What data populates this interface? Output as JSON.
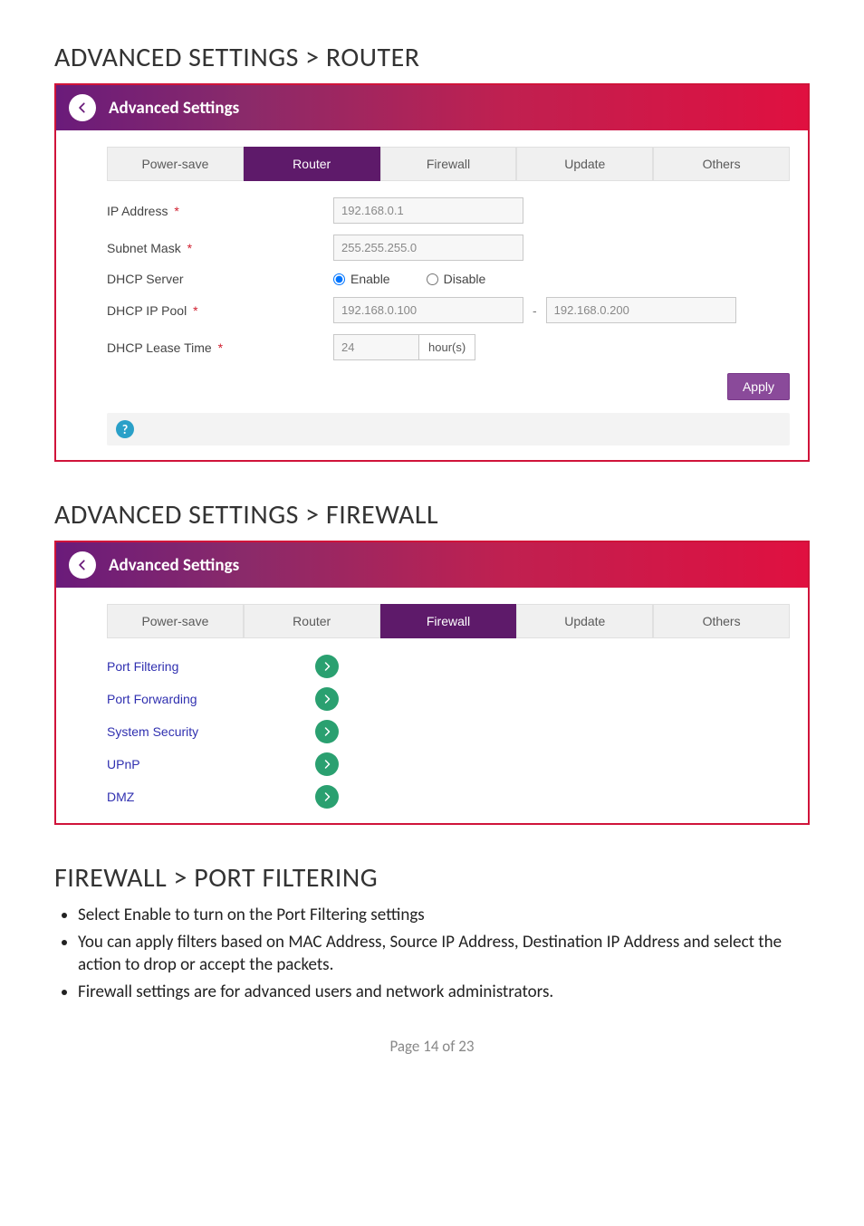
{
  "headings": {
    "router": "ADVANCED SETTINGS > ROUTER",
    "firewall": "ADVANCED SETTINGS > FIREWALL",
    "port_filtering": "FIREWALL > PORT FILTERING"
  },
  "panel": {
    "title": "Advanced Settings"
  },
  "tabs": {
    "power_save": "Power-save",
    "router": "Router",
    "firewall": "Firewall",
    "update": "Update",
    "others": "Others"
  },
  "router_form": {
    "ip_address_label": "IP Address",
    "ip_address_value": "192.168.0.1",
    "subnet_label": "Subnet Mask",
    "subnet_value": "255.255.255.0",
    "dhcp_server_label": "DHCP Server",
    "enable_label": "Enable",
    "disable_label": "Disable",
    "dhcp_pool_label": "DHCP IP Pool",
    "dhcp_pool_start": "192.168.0.100",
    "dhcp_pool_sep": "-",
    "dhcp_pool_end": "192.168.0.200",
    "lease_label": "DHCP Lease Time",
    "lease_value": "24",
    "lease_unit": "hour(s)",
    "required_mark": "*",
    "apply": "Apply",
    "help": "?"
  },
  "firewall_list": {
    "port_filtering": "Port Filtering",
    "port_forwarding": "Port Forwarding",
    "system_security": "System Security",
    "upnp": "UPnP",
    "dmz": "DMZ"
  },
  "bullets": {
    "b1": "Select Enable to turn on the Port Filtering settings",
    "b2": "You can apply filters based on MAC Address, Source IP Address, Destination IP Address and select the action to drop or accept the packets.",
    "b3": "Firewall settings are for advanced users and network administrators."
  },
  "footer": "Page 14 of 23"
}
